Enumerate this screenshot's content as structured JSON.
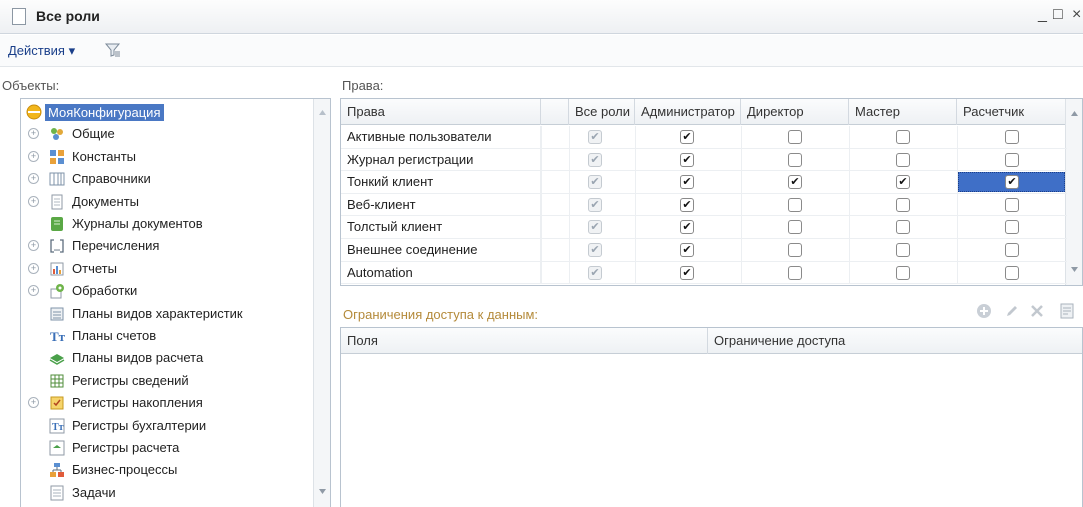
{
  "window": {
    "title": "Все роли",
    "minimize": "_",
    "maximize": "□",
    "close": "×"
  },
  "toolbar": {
    "actions_label": "Действия ▾"
  },
  "objects": {
    "label": "Объекты:",
    "items": [
      {
        "label": "МояКонфигурация",
        "icon": "config-icon",
        "expander": false,
        "selected": true
      },
      {
        "label": "Общие",
        "icon": "common-icon",
        "expander": true
      },
      {
        "label": "Константы",
        "icon": "constants-icon",
        "expander": true
      },
      {
        "label": "Справочники",
        "icon": "catalogs-icon",
        "expander": true
      },
      {
        "label": "Документы",
        "icon": "documents-icon",
        "expander": true
      },
      {
        "label": "Журналы документов",
        "icon": "document-journals-icon",
        "expander": false
      },
      {
        "label": "Перечисления",
        "icon": "enums-icon",
        "expander": true
      },
      {
        "label": "Отчеты",
        "icon": "reports-icon",
        "expander": true
      },
      {
        "label": "Обработки",
        "icon": "dataprocessors-icon",
        "expander": true
      },
      {
        "label": "Планы видов характеристик",
        "icon": "chart-of-characteristic-types-icon",
        "expander": false
      },
      {
        "label": "Планы счетов",
        "icon": "chart-of-accounts-icon",
        "expander": false
      },
      {
        "label": "Планы видов расчета",
        "icon": "chart-of-calculation-types-icon",
        "expander": false
      },
      {
        "label": "Регистры сведений",
        "icon": "information-registers-icon",
        "expander": false
      },
      {
        "label": "Регистры накопления",
        "icon": "accumulation-registers-icon",
        "expander": true
      },
      {
        "label": "Регистры бухгалтерии",
        "icon": "accounting-registers-icon",
        "expander": false
      },
      {
        "label": "Регистры расчета",
        "icon": "calculation-registers-icon",
        "expander": false
      },
      {
        "label": "Бизнес-процессы",
        "icon": "business-processes-icon",
        "expander": false
      },
      {
        "label": "Задачи",
        "icon": "tasks-icon",
        "expander": false
      }
    ]
  },
  "rights": {
    "label": "Права:",
    "columns": [
      "Права",
      "Все роли",
      "Администратор",
      "Директор",
      "Мастер",
      "Расчетчик"
    ],
    "rows": [
      {
        "name": "Активные пользователи",
        "all": true,
        "admin": true,
        "director": false,
        "master": false,
        "calc": false
      },
      {
        "name": "Журнал регистрации",
        "all": true,
        "admin": true,
        "director": false,
        "master": false,
        "calc": false
      },
      {
        "name": "Тонкий клиент",
        "all": true,
        "admin": true,
        "director": true,
        "master": true,
        "calc": true
      },
      {
        "name": "Веб-клиент",
        "all": true,
        "admin": true,
        "director": false,
        "master": false,
        "calc": false
      },
      {
        "name": "Толстый клиент",
        "all": true,
        "admin": true,
        "director": false,
        "master": false,
        "calc": false
      },
      {
        "name": "Внешнее соединение",
        "all": true,
        "admin": true,
        "director": false,
        "master": false,
        "calc": false
      },
      {
        "name": "Automation",
        "all": true,
        "admin": true,
        "director": false,
        "master": false,
        "calc": false
      }
    ]
  },
  "restrictions": {
    "label": "Ограничения доступа к данным:",
    "columns": [
      "Поля",
      "Ограничение доступа"
    ]
  },
  "colors": {
    "selection": "#3f6fc7",
    "border": "#b8c3cf",
    "restrict_label": "#b48a3a"
  }
}
